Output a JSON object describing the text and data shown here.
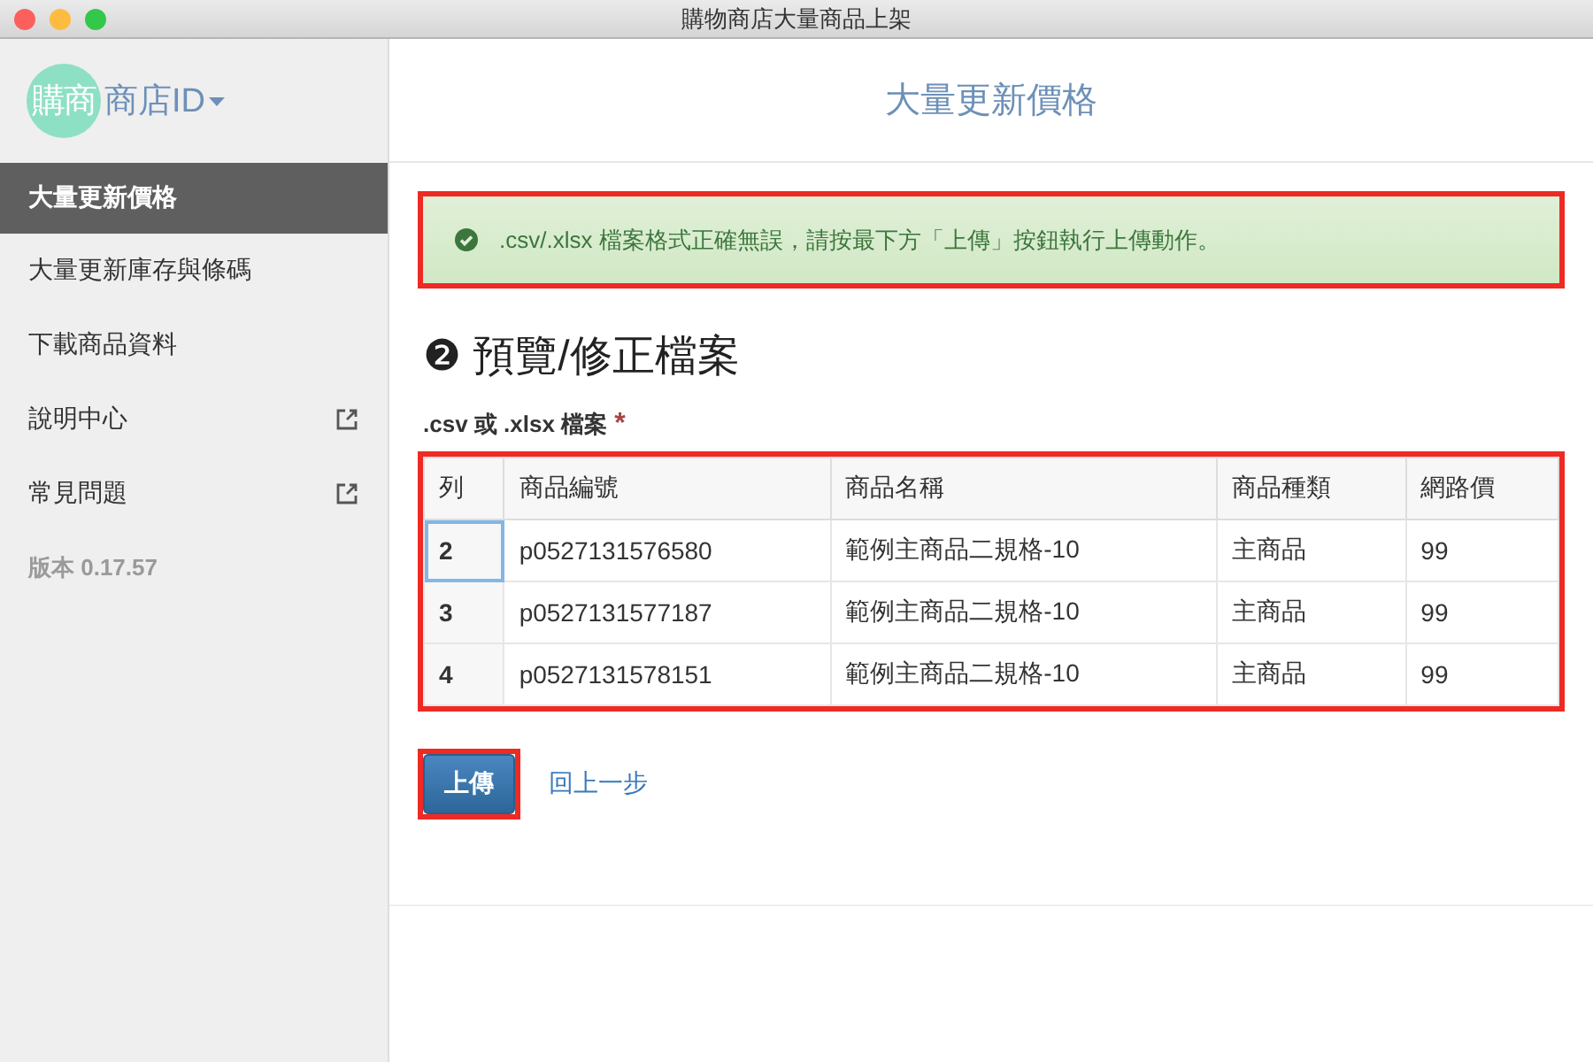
{
  "window": {
    "title": "購物商店大量商品上架"
  },
  "sidebar": {
    "logo": "購商",
    "store": "商店ID",
    "items": [
      {
        "label": "大量更新價格",
        "selected": true,
        "kind": "page"
      },
      {
        "label": "大量更新庫存與條碼",
        "selected": false,
        "kind": "page"
      },
      {
        "label": "下載商品資料",
        "selected": false,
        "kind": "page"
      },
      {
        "label": "說明中心",
        "selected": false,
        "kind": "external"
      },
      {
        "label": "常見問題",
        "selected": false,
        "kind": "external"
      }
    ],
    "version": "版本 0.17.57"
  },
  "main": {
    "title": "大量更新價格",
    "alert": {
      "text": ".csv/.xlsx 檔案格式正確無誤，請按最下方「上傳」按鈕執行上傳動作。",
      "highlighted": true
    },
    "heading": "❷ 預覽/修正檔案",
    "file_label": ".csv 或 .xlsx 檔案",
    "required_mark": "*",
    "table": {
      "highlighted": true,
      "columns": [
        "列",
        "商品編號",
        "商品名稱",
        "商品種類",
        "網路價"
      ],
      "rows": [
        {
          "cells": [
            "2",
            "p0527131576580",
            "範例主商品二規格-10",
            "主商品",
            "99"
          ],
          "selected": true
        },
        {
          "cells": [
            "3",
            "p0527131577187",
            "範例主商品二規格-10",
            "主商品",
            "99"
          ],
          "selected": false
        },
        {
          "cells": [
            "4",
            "p0527131578151",
            "範例主商品二規格-10",
            "主商品",
            "99"
          ],
          "selected": false
        }
      ]
    },
    "upload_button": {
      "label": "上傳",
      "highlighted": true
    },
    "back_link": "回上一步"
  }
}
